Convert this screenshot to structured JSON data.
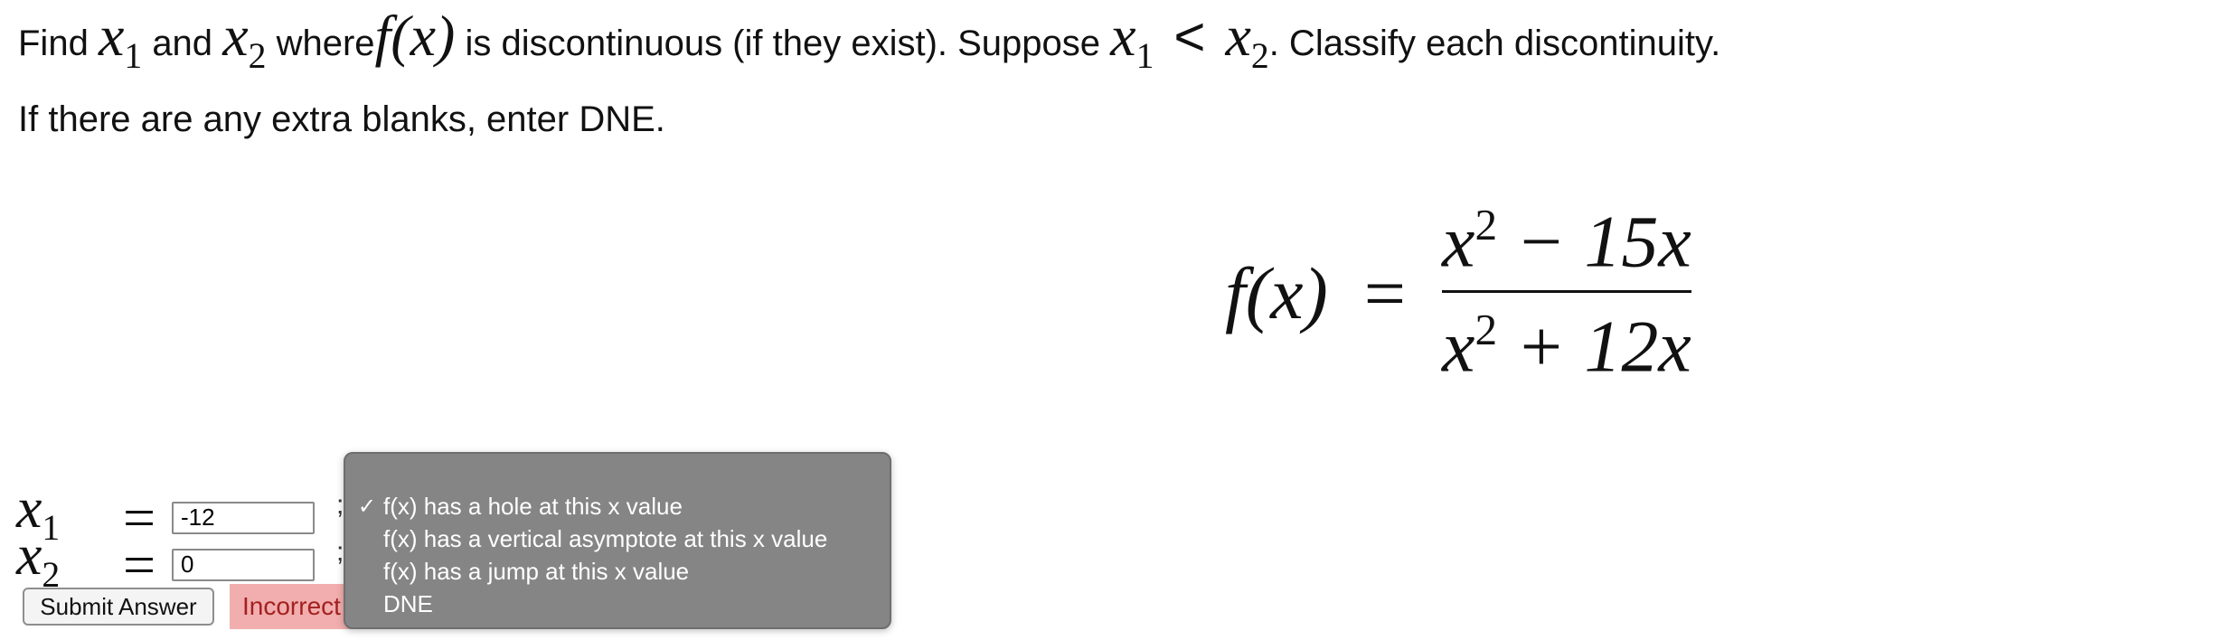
{
  "prompt": {
    "find": "Find",
    "x1_var": "x",
    "x1_sub": "1",
    "and": "and",
    "x2_var": "x",
    "x2_sub": "2",
    "where": "where",
    "f_of_x": "f(x)",
    "is_discontinuous": "is discontinuous (if they exist). Suppose",
    "suppose_x1_var": "x",
    "suppose_x1_sub": "1",
    "less_than": "<",
    "suppose_x2_var": "x",
    "suppose_x2_sub": "2",
    "classify": ". Classify each discontinuity."
  },
  "blank_note": "If there are any extra blanks, enter DNE.",
  "formula": {
    "lhs": "f(x)",
    "equals": "=",
    "numerator_base": "x",
    "numerator_exp": "2",
    "numerator_rest": "− 15x",
    "denominator_base": "x",
    "denominator_exp": "2",
    "denominator_rest": "+ 12x"
  },
  "answers": [
    {
      "var": "x",
      "sub": "1",
      "equals": "=",
      "value": "-12",
      "separator": ";"
    },
    {
      "var": "x",
      "sub": "2",
      "equals": "=",
      "value": "0",
      "separator": ";"
    }
  ],
  "submit_label": "Submit Answer",
  "result_label": "Incorrect",
  "dropdown": {
    "selected_check": "✓",
    "options": [
      "f(x) has a hole at this x value",
      "f(x) has a vertical asymptote at this x value",
      "f(x) has a jump at this x value",
      "DNE"
    ]
  },
  "colors": {
    "dropdown_bg": "#858585",
    "result_bg": "#f2aeae",
    "result_text": "#a32020"
  }
}
